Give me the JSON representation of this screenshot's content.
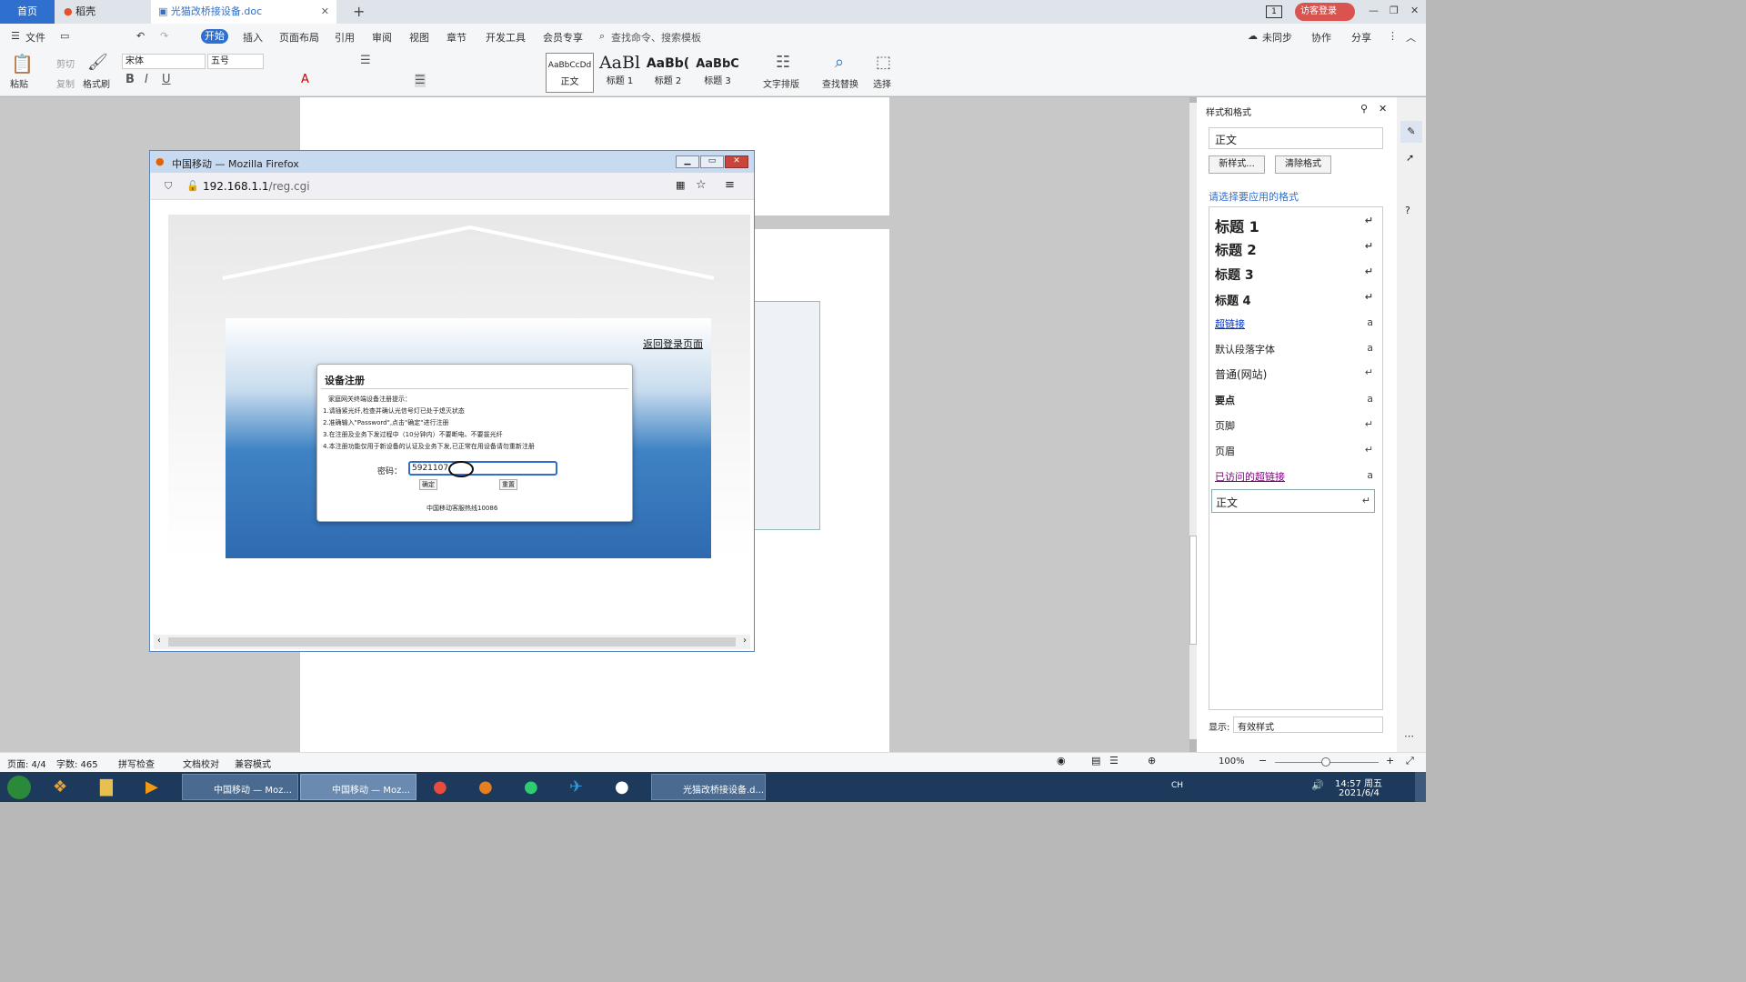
{
  "tabs": {
    "home": "首页",
    "daoke": "稻壳",
    "doc": "光猫改桥接设备.doc",
    "new_tab": "+",
    "slide_num": "1",
    "guest_login": "访客登录"
  },
  "menu": {
    "file": "文件",
    "start": "开始",
    "insert": "插入",
    "layout": "页面布局",
    "reference": "引用",
    "review": "审阅",
    "view": "视图",
    "chapter": "章节",
    "dev": "开发工具",
    "member": "会员专享",
    "search": "查找命令、搜索模板",
    "unsync": "未同步",
    "collab": "协作",
    "share": "分享"
  },
  "ribbon": {
    "paste": "粘贴",
    "cut": "剪切",
    "copy": "复制",
    "format_painter": "格式刷",
    "font": "宋体",
    "size": "五号",
    "style_preview_normal": "AaBbCcDd",
    "style_preview_h1": "AaBl",
    "style_preview_h2": "AaBb(",
    "style_preview_h3": "AaBbC",
    "style_normal": "正文",
    "style_h1": "标题 1",
    "style_h2": "标题 2",
    "style_h3": "标题 3",
    "text_layout": "文字排版",
    "find_replace": "查找替换",
    "select": "选择"
  },
  "firefox": {
    "title": "中国移动 — Mozilla Firefox",
    "url_host": "192.168.1.1",
    "url_path": "/reg.cgi",
    "back_login": "返回登录页面",
    "dialog_title": "设备注册",
    "hint_title": "家庭网关终端设备注册提示：",
    "hint1": "1.请插紧光纤,检查并确认光信号灯已处于熄灭状态",
    "hint2": "2.准确输入\"Password\",点击\"确定\"进行注册",
    "hint3": "3.在注册及业务下发过程中（10分钟内）不要断电、不要拔光纤",
    "hint4": "4.本注册功能仅用于新设备的认证及业务下发,已正常在用设备请勿重新注册",
    "pwd_label": "密码：",
    "pwd_value": "5921107",
    "ok": "确定",
    "reset": "重置",
    "hotline": "中国移动客服热线10086"
  },
  "sidepanel": {
    "title": "样式和格式",
    "current_style": "正文",
    "new_style": "新样式...",
    "clear_format": "清除格式",
    "choose_label": "请选择要应用的格式",
    "items": [
      {
        "label": "标题  1",
        "mark": "↵"
      },
      {
        "label": "标题  2",
        "mark": "↵"
      },
      {
        "label": "标题  3",
        "mark": "↵"
      },
      {
        "label": "标题  4",
        "mark": "↵"
      },
      {
        "label": "超链接",
        "mark": "a"
      },
      {
        "label": "默认段落字体",
        "mark": "a"
      },
      {
        "label": "普通(网站)",
        "mark": "↵"
      },
      {
        "label": "要点",
        "mark": "a"
      },
      {
        "label": "页脚",
        "mark": "↵"
      },
      {
        "label": "页眉",
        "mark": "↵"
      },
      {
        "label": "已访问的超链接",
        "mark": "a"
      },
      {
        "label": "正文",
        "mark": "↵"
      }
    ],
    "show_label": "显示:",
    "show_value": "有效样式"
  },
  "status": {
    "page": "页面: 4/4",
    "words": "字数: 465",
    "spell": "拼写检查",
    "proof": "文档校对",
    "compat": "兼容模式",
    "zoom": "100%"
  },
  "taskbar": {
    "ff1": "中国移动 — Moz...",
    "ff2": "中国移动 — Moz...",
    "wps": "光猫改桥接设备.d...",
    "lang": "CH",
    "time": "14:57 周五",
    "date": "2021/6/4"
  },
  "colors": {
    "accent": "#2f6fce",
    "guest": "#d9534f",
    "link": "#0033cc",
    "visited": "#800080"
  }
}
